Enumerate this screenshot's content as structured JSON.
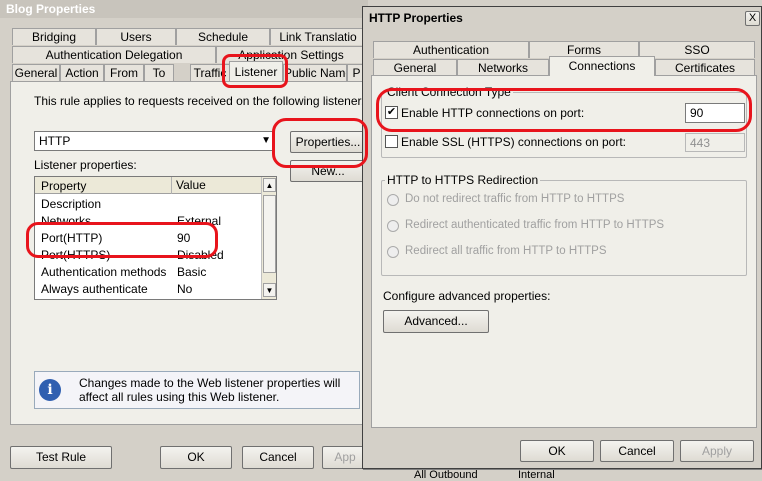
{
  "blog": {
    "title": "Blog Properties",
    "tabs_row1": [
      "Bridging",
      "Users",
      "Schedule",
      "Link Translatio"
    ],
    "tabs_row2": [
      "Authentication Delegation",
      "Application Settings"
    ],
    "tabs_row3": [
      "General",
      "Action",
      "From",
      "To",
      "Traffic",
      "Listener",
      "Public Name",
      "P"
    ],
    "rule_text": "This rule applies to requests received on the following listener.",
    "listener_value": "HTTP",
    "properties_button": "Properties...",
    "new_button": "New...",
    "listener_props_label": "Listener properties:",
    "col_property": "Property",
    "col_value": "Value",
    "rows": [
      {
        "property": "Description",
        "value": ""
      },
      {
        "property": "Networks",
        "value": "External"
      },
      {
        "property": "Port(HTTP)",
        "value": "90"
      },
      {
        "property": "Port(HTTPS)",
        "value": "Disabled"
      },
      {
        "property": "Authentication methods",
        "value": "Basic"
      },
      {
        "property": "Always authenticate",
        "value": "No"
      }
    ],
    "info_text": "Changes made to the Web listener properties will affect all rules using this Web listener.",
    "test_rule": "Test Rule",
    "ok": "OK",
    "cancel": "Cancel",
    "apply": "App"
  },
  "http": {
    "title": "HTTP Properties",
    "close": "X",
    "tabs_row1": [
      "Authentication",
      "Forms",
      "SSO"
    ],
    "tabs_row2": [
      "General",
      "Networks",
      "Connections",
      "Certificates"
    ],
    "client_type_label": "Client Connection Type",
    "enable_http_label": "Enable HTTP connections on port:",
    "http_port": "90",
    "enable_ssl_label": "Enable SSL (HTTPS) connections on port:",
    "ssl_port": "443",
    "redirect_label": "HTTP to HTTPS Redirection",
    "redirect_options": [
      "Do not redirect traffic from HTTP to HTTPS",
      "Redirect authenticated traffic from HTTP to HTTPS",
      "Redirect all traffic from HTTP to HTTPS"
    ],
    "advanced_label": "Configure advanced properties:",
    "advanced_button": "Advanced...",
    "ok": "OK",
    "cancel": "Cancel",
    "apply": "Apply"
  },
  "background": {
    "bottom_text_1": "All Outbound",
    "bottom_text_2": "Internal"
  },
  "colors": {
    "highlight": "#e8141c",
    "title_bar": "#c8c4bc"
  }
}
